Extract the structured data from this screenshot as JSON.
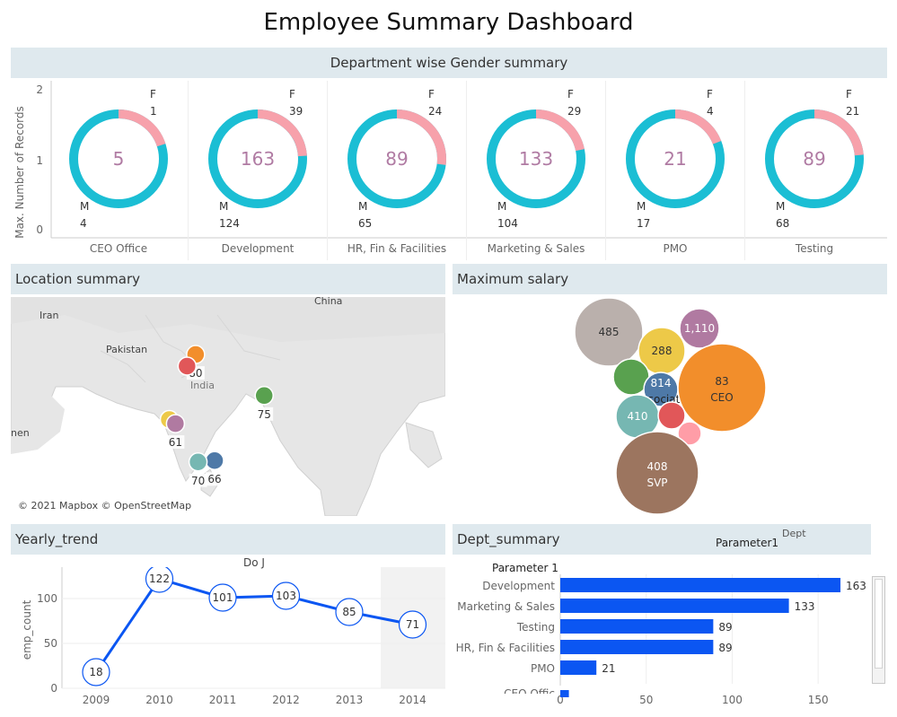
{
  "page_title": "Employee Summary Dashboard",
  "colors": {
    "female": "#f7a1ab",
    "male": "#1bbed4",
    "center_text": "#b07ba3",
    "bar": "#0b56f2",
    "line": "#0b56f2",
    "band": "#dfe9ee"
  },
  "gender": {
    "header": "Department wise Gender summary",
    "y_axis_label": "Max. Number of Records",
    "y_ticks": [
      "2",
      "1",
      "0"
    ],
    "f_label": "F",
    "m_label": "M"
  },
  "location": {
    "header": "Location summary",
    "attribution": "© 2021 Mapbox © OpenStreetMap",
    "place_names": {
      "iran": "Iran",
      "pakistan": "Pakistan",
      "china": "China",
      "india": "India",
      "oman": "nen"
    }
  },
  "salary": {
    "header": "Maximum salary"
  },
  "yearly": {
    "header": "Yearly_trend",
    "subtitle": "Do J",
    "y_axis_label": "emp_count"
  },
  "dept": {
    "header": "Dept_summary",
    "parameter_title": "Parameter1",
    "dept_title": "Dept",
    "parameter_label": "Parameter 1",
    "partial_row": "CEO Offic"
  },
  "chart_data": [
    {
      "type": "pie",
      "title": "Department wise Gender summary",
      "ylabel": "Max. Number of Records",
      "ylim": [
        0,
        2
      ],
      "categories": [
        "CEO Office",
        "Development",
        "HR, Fin & Facilities",
        "Marketing & Sales",
        "PMO",
        "Testing"
      ],
      "series": [
        {
          "name": "F",
          "values": [
            1,
            39,
            24,
            29,
            4,
            21
          ]
        },
        {
          "name": "M",
          "values": [
            4,
            124,
            65,
            104,
            17,
            68
          ]
        }
      ],
      "totals": [
        5,
        163,
        89,
        133,
        21,
        89
      ]
    },
    {
      "type": "scatter",
      "title": "Location summary",
      "points": [
        {
          "label": "80",
          "lon": 77.2,
          "lat": 28.6,
          "color": "#f28e2b"
        },
        {
          "label": "",
          "lon": 75.8,
          "lat": 26.9,
          "color": "#e15759"
        },
        {
          "label": "75",
          "lon": 88.4,
          "lat": 22.6,
          "color": "#59a14f"
        },
        {
          "label": "",
          "lon": 72.9,
          "lat": 19.1,
          "color": "#edc948"
        },
        {
          "label": "61",
          "lon": 73.9,
          "lat": 18.5,
          "color": "#b07aa1"
        },
        {
          "label": "66",
          "lon": 80.3,
          "lat": 13.1,
          "color": "#4e79a7"
        },
        {
          "label": "70",
          "lon": 77.6,
          "lat": 12.9,
          "color": "#76b7b2"
        }
      ]
    },
    {
      "type": "scatter",
      "title": "Maximum salary",
      "bubbles": [
        {
          "value": "485",
          "name": "",
          "color": "#bab0ac"
        },
        {
          "value": "1,110",
          "name": "",
          "color": "#b07aa1"
        },
        {
          "value": "288",
          "name": "",
          "color": "#edc948"
        },
        {
          "value": "",
          "name": "",
          "color": "#59a14f"
        },
        {
          "value": "814",
          "name": "Associate",
          "color": "#4e79a7"
        },
        {
          "value": "83",
          "name": "CEO",
          "color": "#f28e2b"
        },
        {
          "value": "410",
          "name": "",
          "color": "#76b7b2"
        },
        {
          "value": "",
          "name": "",
          "color": "#e15759"
        },
        {
          "value": "",
          "name": "",
          "color": "#ff9da7"
        },
        {
          "value": "408",
          "name": "SVP",
          "color": "#9c755f"
        }
      ]
    },
    {
      "type": "line",
      "title": "Yearly_trend",
      "ylabel": "emp_count",
      "x": [
        "2009",
        "2010",
        "2011",
        "2012",
        "2013",
        "2014"
      ],
      "values": [
        18,
        122,
        101,
        103,
        85,
        71
      ],
      "ylim": [
        0,
        135
      ],
      "y_ticks": [
        0,
        50,
        100
      ],
      "shaded_last": true
    },
    {
      "type": "bar",
      "orientation": "horizontal",
      "title": "Dept_summary",
      "categories": [
        "Development",
        "Marketing & Sales",
        "Testing",
        "HR, Fin & Facilities",
        "PMO",
        "CEO Office"
      ],
      "values": [
        163,
        133,
        89,
        89,
        21,
        5
      ],
      "xlim": [
        0,
        175
      ],
      "x_ticks": [
        0,
        50,
        100,
        150
      ]
    }
  ]
}
